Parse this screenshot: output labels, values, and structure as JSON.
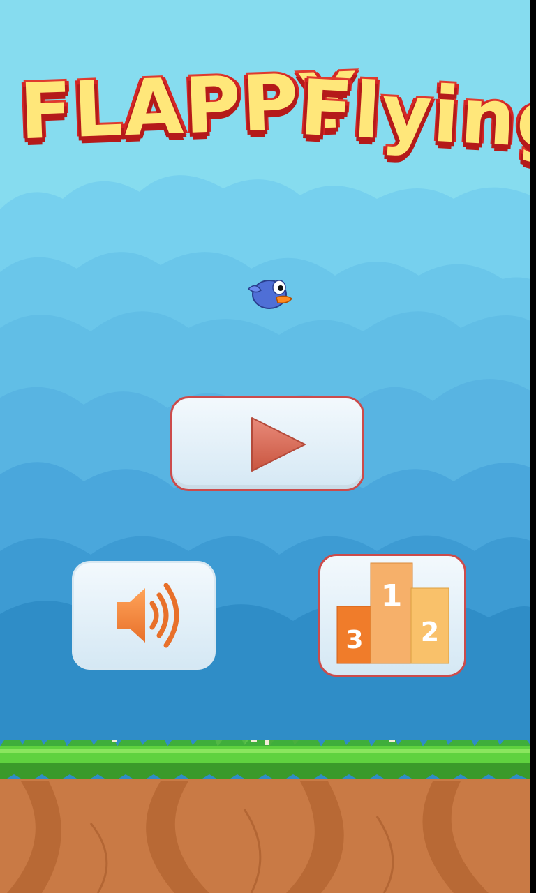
{
  "game": {
    "title_word1": "FLAPPY",
    "title_word2": "Flying"
  },
  "buttons": {
    "play": {
      "icon": "play-icon"
    },
    "sound": {
      "icon": "speaker-icon"
    },
    "leaderboard": {
      "icon": "podium-icon",
      "places": [
        "1",
        "2",
        "3"
      ]
    }
  },
  "colors": {
    "title_fill": "#ffe77a",
    "title_outline": "#e03a2e",
    "button_border": "#cc4b4b",
    "play_triangle": "#dd6a5a",
    "speaker": "#f58b3f"
  }
}
